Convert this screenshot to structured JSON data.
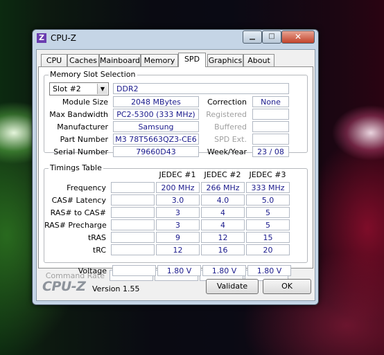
{
  "window": {
    "title": "CPU-Z",
    "icon_letter": "Z",
    "minimize_glyph": "▁",
    "maximize_glyph": "□",
    "close_glyph": "✕"
  },
  "tabs": [
    "CPU",
    "Caches",
    "Mainboard",
    "Memory",
    "SPD",
    "Graphics",
    "About"
  ],
  "slot": {
    "legend": "Memory Slot Selection",
    "selected": "Slot #2",
    "type": "DDR2",
    "module_size_label": "Module Size",
    "module_size": "2048 MBytes",
    "max_bandwidth_label": "Max Bandwidth",
    "max_bandwidth": "PC2-5300 (333 MHz)",
    "manufacturer_label": "Manufacturer",
    "manufacturer": "Samsung",
    "part_number_label": "Part Number",
    "part_number": "M3 78T5663QZ3-CE6",
    "serial_number_label": "Serial Number",
    "serial_number": "79660D43",
    "correction_label": "Correction",
    "correction": "None",
    "registered_label": "Registered",
    "registered": "",
    "buffered_label": "Buffered",
    "buffered": "",
    "spd_ext_label": "SPD Ext.",
    "spd_ext": "",
    "week_year_label": "Week/Year",
    "week_year": "23 / 08"
  },
  "timings": {
    "legend": "Timings Table",
    "headers": [
      "JEDEC #1",
      "JEDEC #2",
      "JEDEC #3"
    ],
    "rows": [
      {
        "label": "Frequency",
        "values": [
          "200 MHz",
          "266 MHz",
          "333 MHz"
        ]
      },
      {
        "label": "CAS# Latency",
        "values": [
          "3.0",
          "4.0",
          "5.0"
        ]
      },
      {
        "label": "RAS# to CAS#",
        "values": [
          "3",
          "4",
          "5"
        ]
      },
      {
        "label": "RAS# Precharge",
        "values": [
          "3",
          "4",
          "5"
        ]
      },
      {
        "label": "tRAS",
        "values": [
          "9",
          "12",
          "15"
        ]
      },
      {
        "label": "tRC",
        "values": [
          "12",
          "16",
          "20"
        ]
      },
      {
        "label": "Command Rate",
        "values": [
          "",
          "",
          ""
        ]
      },
      {
        "label": "Voltage",
        "values": [
          "1.80 V",
          "1.80 V",
          "1.80 V"
        ]
      }
    ]
  },
  "footer": {
    "brand": "CPU-Z",
    "version": "Version 1.55",
    "validate": "Validate",
    "ok": "OK"
  }
}
